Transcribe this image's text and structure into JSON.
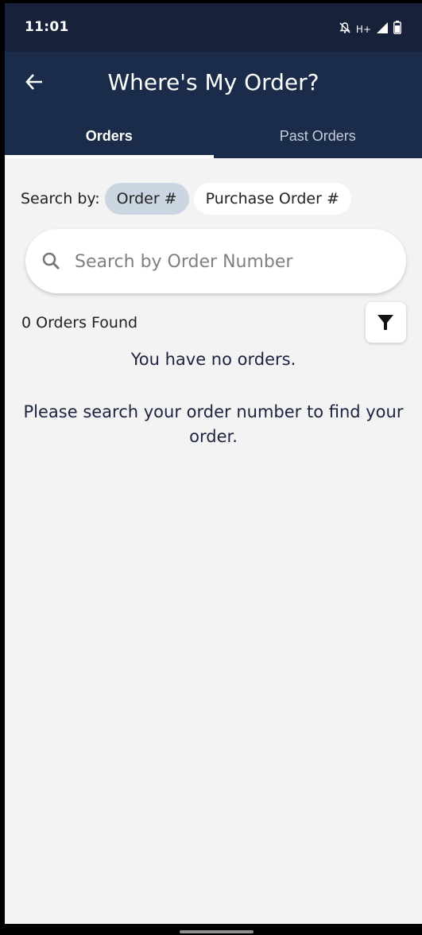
{
  "status_bar": {
    "time": "11:01",
    "network_label": "H+",
    "icons": [
      "notifications-off-icon",
      "signal-icon",
      "battery-icon"
    ]
  },
  "app_bar": {
    "title": "Where's My Order?",
    "back_icon": "arrow-left-icon"
  },
  "tabs": [
    {
      "label": "Orders",
      "active": true
    },
    {
      "label": "Past Orders",
      "active": false
    }
  ],
  "search_by": {
    "label": "Search by:",
    "options": [
      {
        "label": "Order #",
        "selected": true
      },
      {
        "label": "Purchase Order #",
        "selected": false
      }
    ]
  },
  "search": {
    "placeholder": "Search by Order Number",
    "value": ""
  },
  "results": {
    "count_text": "0 Orders Found",
    "filter_icon": "filter-icon"
  },
  "empty_state": {
    "title": "You have no orders.",
    "message": "Please search your order number to find your order."
  },
  "colors": {
    "status_bar": "#18213a",
    "app_bar": "#1b2b4a",
    "background": "#f3f3f3",
    "chip_selected": "#ccd6e2",
    "text_dark": "#1b2340"
  }
}
